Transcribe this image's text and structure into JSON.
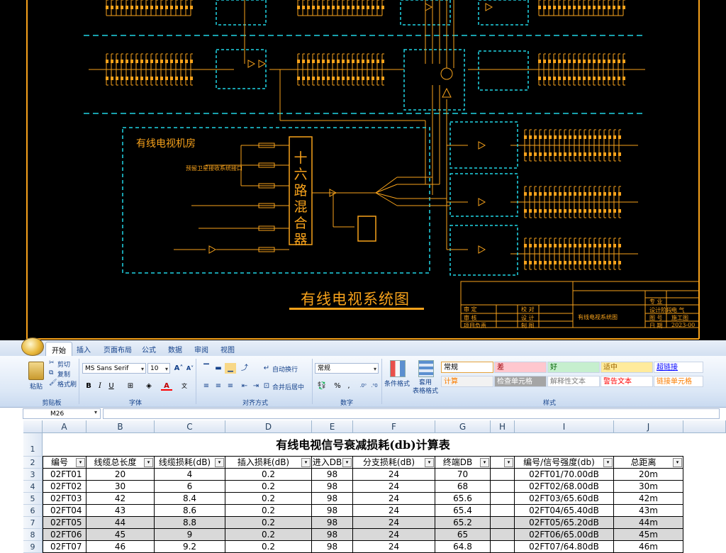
{
  "cad": {
    "title": "有线电视系统图",
    "headend_room": "有线电视机房",
    "mixer_chars": [
      "十",
      "六",
      "路",
      "混",
      "合",
      "器"
    ],
    "satellite_label": "预留卫星接收系统接口",
    "sign_left": [
      "审 定",
      "审 核",
      "项目负责"
    ],
    "sign_mid": [
      "校 对",
      "设 计",
      "制 图"
    ],
    "sign_right": [
      "专 业",
      "设计阶段",
      "图 号",
      "日 期"
    ],
    "sign_right_values": [
      "电 气",
      "施工图",
      "2023-00"
    ],
    "drawing_name": "有线电视系统图",
    "colors": {
      "line": "#f7a21b",
      "frame": "#20d6e6",
      "bg": "#000000"
    }
  },
  "excel": {
    "tabs": [
      "开始",
      "插入",
      "页面布局",
      "公式",
      "数据",
      "审阅",
      "视图"
    ],
    "active_tab": "开始",
    "clipboard": {
      "paste": "粘贴",
      "cut": "剪切",
      "copy": "复制",
      "format_painter": "格式刷",
      "group": "剪贴板"
    },
    "font": {
      "name": "MS Sans Serif",
      "size": "10",
      "group": "字体"
    },
    "alignment": {
      "wrap": "自动换行",
      "merge": "合并后居中",
      "group": "对齐方式"
    },
    "number": {
      "format": "常规",
      "group": "数字"
    },
    "styles": {
      "conditional": "条件格式",
      "table_format": "套用\n表格格式",
      "group": "样式",
      "cells": [
        {
          "label": "常规",
          "bg": "#ffffff",
          "color": "#000000"
        },
        {
          "label": "差",
          "bg": "#ffc7ce",
          "color": "#9c0006"
        },
        {
          "label": "好",
          "bg": "#c6efce",
          "color": "#006100"
        },
        {
          "label": "适中",
          "bg": "#ffeb9c",
          "color": "#9c6500"
        },
        {
          "label": "超链接",
          "bg": "#ffffff",
          "color": "#0000ff"
        },
        {
          "label": "计算",
          "bg": "#f2f2f2",
          "color": "#fa7d00"
        },
        {
          "label": "检查单元格",
          "bg": "#a5a5a5",
          "color": "#ffffff"
        },
        {
          "label": "解释性文本",
          "bg": "#ffffff",
          "color": "#7f7f7f"
        },
        {
          "label": "警告文本",
          "bg": "#ffffff",
          "color": "#ff0000"
        },
        {
          "label": "链接单元格",
          "bg": "#ffffff",
          "color": "#fa7d00"
        }
      ]
    },
    "namebox": "M26",
    "columns": [
      "A",
      "B",
      "C",
      "D",
      "E",
      "F",
      "G",
      "H",
      "I",
      "J"
    ],
    "rows": [
      "1",
      "2",
      "3",
      "4",
      "5",
      "6",
      "7",
      "8",
      "9"
    ],
    "sheet_title": "有线电视信号衰减损耗(db)计算表",
    "headers": [
      "编号",
      "线缆总长度",
      "线缆损耗(dB)",
      "插入损耗(dB)",
      "进入DB",
      "分支损耗(dB)",
      "终端DB",
      "",
      "编号/信号强度(db)",
      "总距离"
    ],
    "data": [
      [
        "02FT01",
        "20",
        "4",
        "0.2",
        "98",
        "24",
        "70",
        "",
        "02FT01/70.00dB",
        "20m"
      ],
      [
        "02FT02",
        "30",
        "6",
        "0.2",
        "98",
        "24",
        "68",
        "",
        "02FT02/68.00dB",
        "30m"
      ],
      [
        "02FT03",
        "42",
        "8.4",
        "0.2",
        "98",
        "24",
        "65.6",
        "",
        "02FT03/65.60dB",
        "42m"
      ],
      [
        "02FT04",
        "43",
        "8.6",
        "0.2",
        "98",
        "24",
        "65.4",
        "",
        "02FT04/65.40dB",
        "43m"
      ],
      [
        "02FT05",
        "44",
        "8.8",
        "0.2",
        "98",
        "24",
        "65.2",
        "",
        "02FT05/65.20dB",
        "44m"
      ],
      [
        "02FT06",
        "45",
        "9",
        "0.2",
        "98",
        "24",
        "65",
        "",
        "02FT06/65.00dB",
        "45m"
      ],
      [
        "02FT07",
        "46",
        "9.2",
        "0.2",
        "98",
        "24",
        "64.8",
        "",
        "02FT07/64.80dB",
        "46m"
      ]
    ]
  }
}
